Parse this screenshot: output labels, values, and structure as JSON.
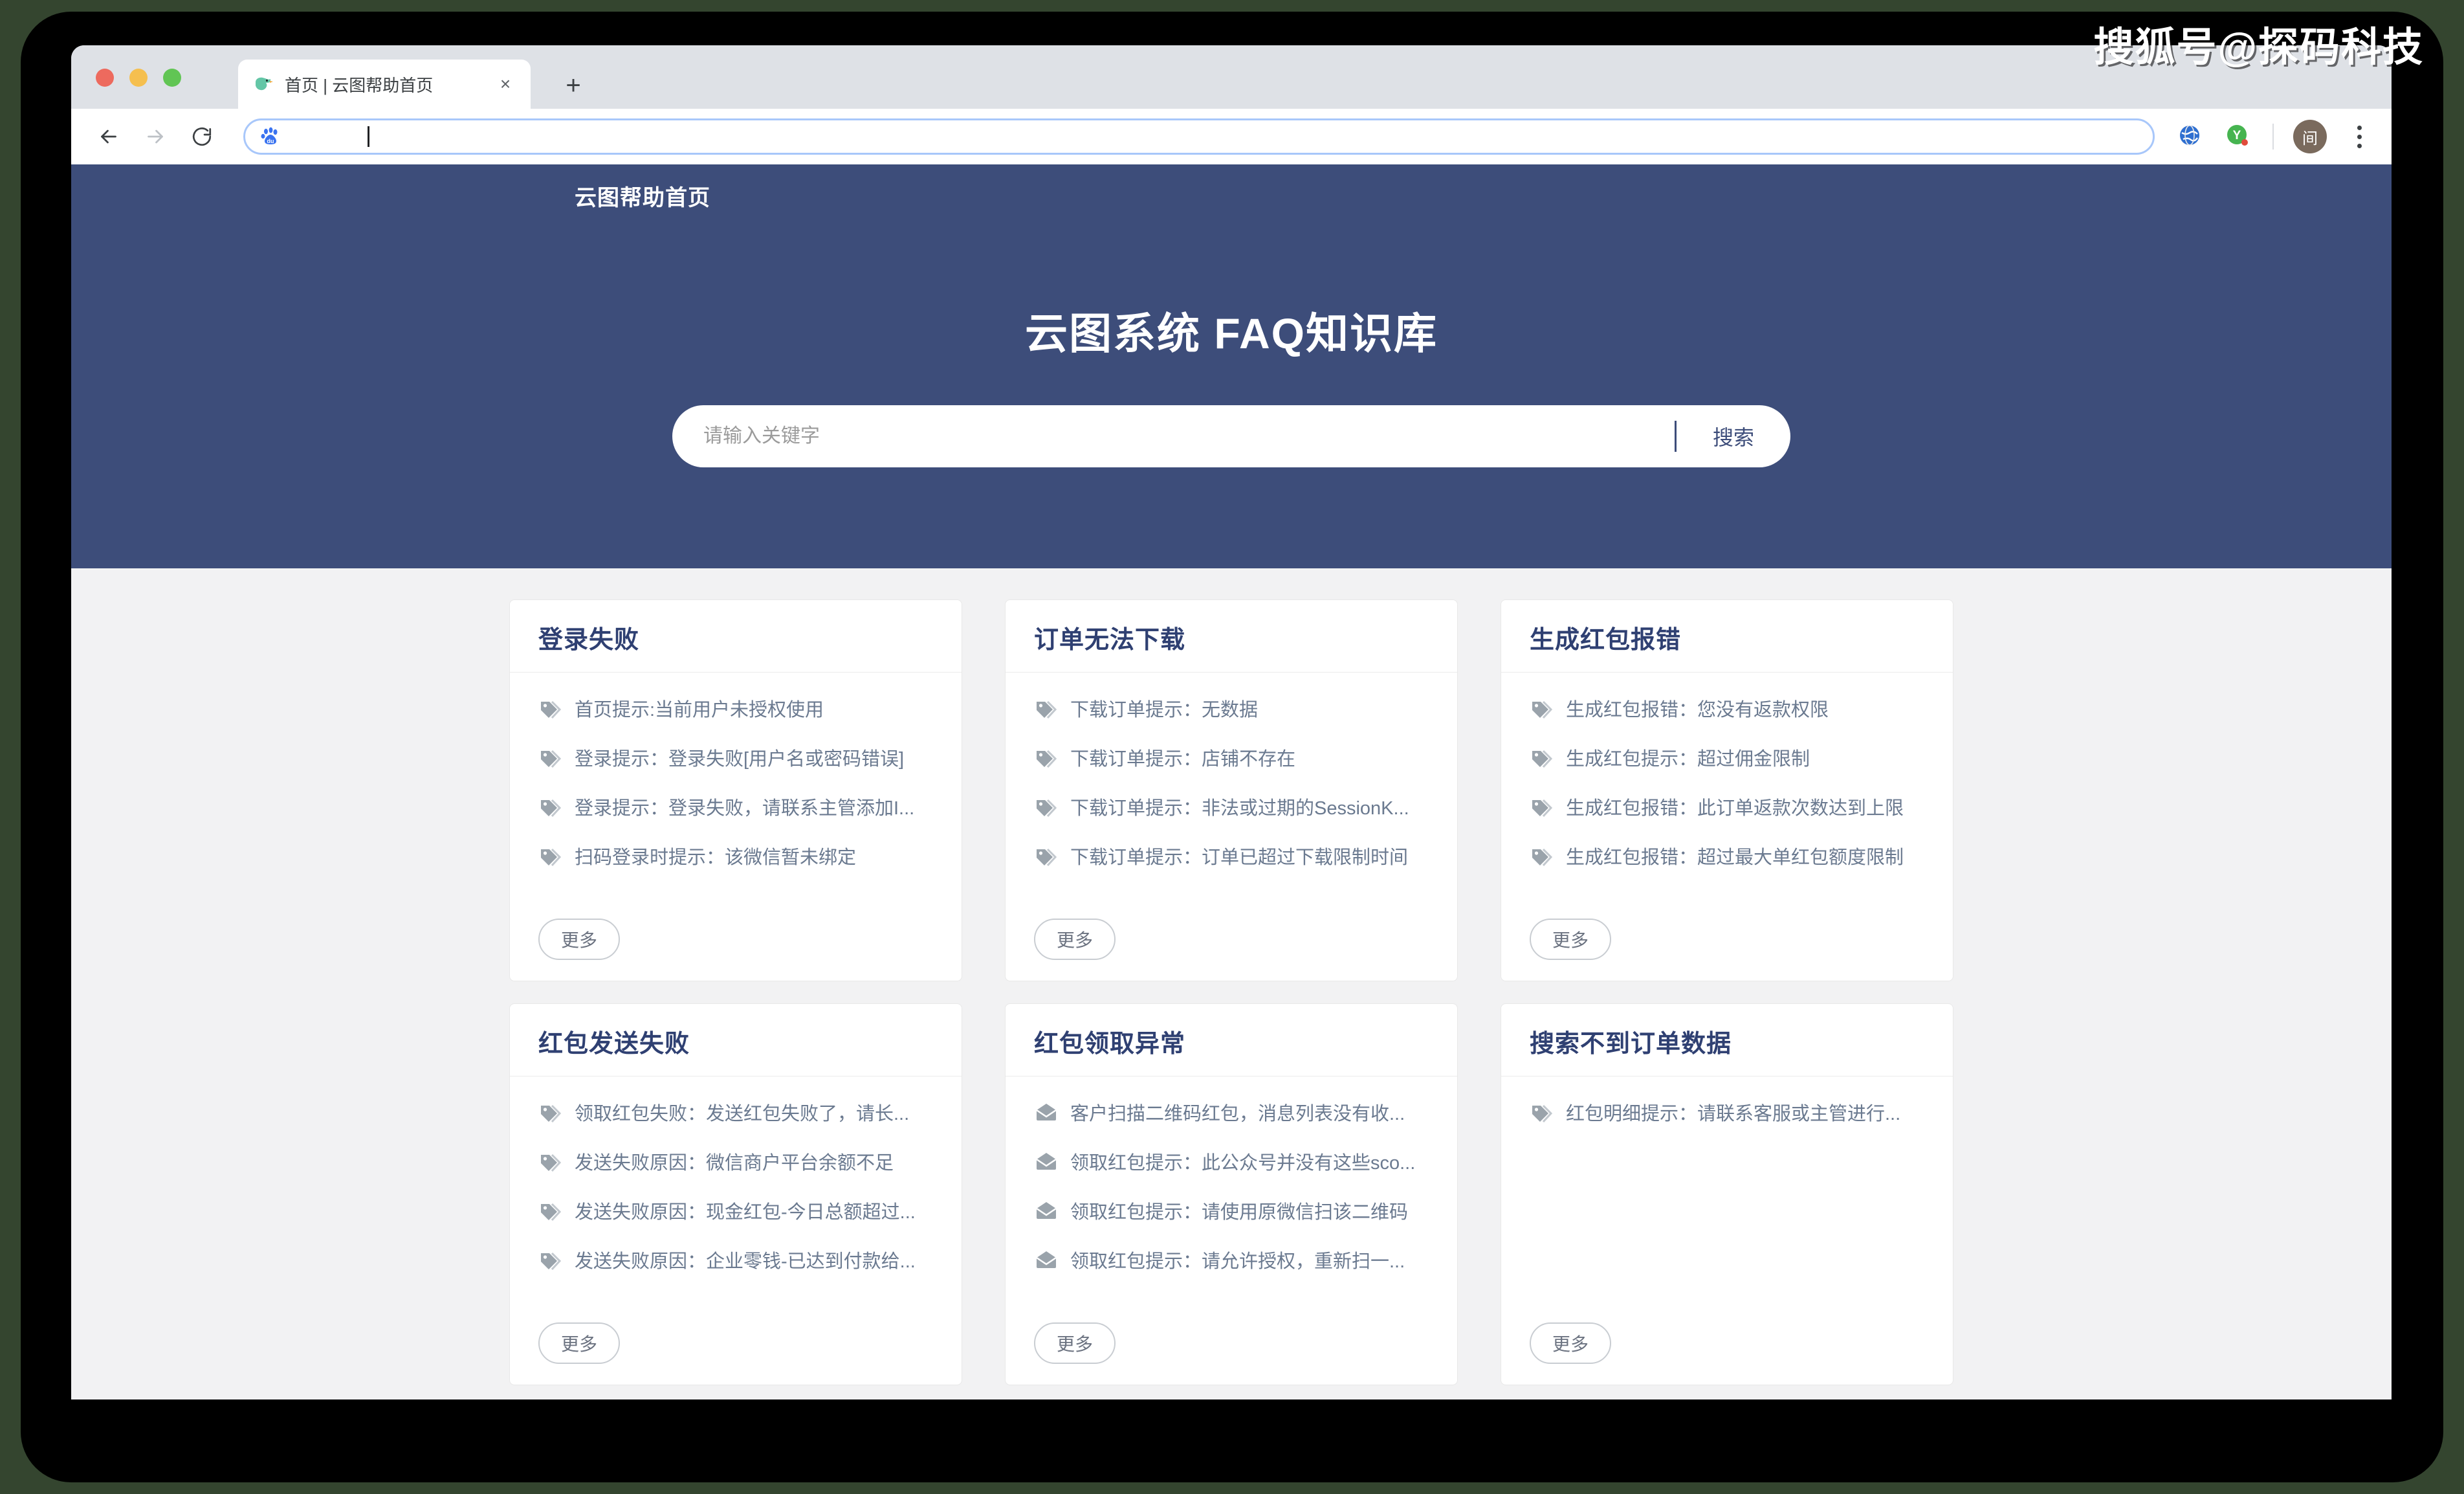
{
  "watermark": "搜狐号@探码科技",
  "browser": {
    "tab": {
      "title": "首页 | 云图帮助首页",
      "favicon": "bird-icon",
      "close": "×"
    },
    "new_tab": "+",
    "back_icon": "back-arrow-icon",
    "forward_icon": "forward-arrow-icon",
    "reload_icon": "reload-icon",
    "omnibox": {
      "value": "",
      "placeholder": "",
      "site_icon": "baidu-paw-icon"
    },
    "toolbar_icons": [
      "globe-icon",
      "youdao-icon"
    ],
    "avatar_label": "间",
    "menu_icon": "kebab-menu-icon"
  },
  "page": {
    "brand": "云图帮助首页",
    "hero_title": "云图系统 FAQ知识库",
    "search": {
      "placeholder": "请输入关键字",
      "value": "",
      "button": "搜索"
    },
    "more_label": "更多",
    "colors": {
      "hero_bg": "#3d4d7a",
      "content_bg": "#f2f2f3",
      "card_title": "#2f4072",
      "item_text": "#6b7a90"
    },
    "cards": [
      {
        "title": "登录失败",
        "icon": "tag-icon",
        "items": [
          "首页提示:当前用户未授权使用",
          "登录提示：登录失败[用户名或密码错误]",
          "登录提示：登录失败，请联系主管添加I...",
          "扫码登录时提示：该微信暂未绑定"
        ]
      },
      {
        "title": "订单无法下载",
        "icon": "tag-icon",
        "items": [
          "下载订单提示：无数据",
          "下载订单提示：店铺不存在",
          "下载订单提示：非法或过期的SessionK...",
          "下载订单提示：订单已超过下载限制时间"
        ]
      },
      {
        "title": "生成红包报错",
        "icon": "tag-icon",
        "items": [
          "生成红包报错：您没有返款权限",
          "生成红包提示：超过佣金限制",
          "生成红包报错：此订单返款次数达到上限",
          "生成红包报错：超过最大单红包额度限制"
        ]
      },
      {
        "title": "红包发送失败",
        "icon": "tag-icon",
        "items": [
          "领取红包失败：发送红包失败了，请长...",
          "发送失败原因：微信商户平台余额不足",
          "发送失败原因：现金红包-今日总额超过...",
          "发送失败原因：企业零钱-已达到付款给..."
        ]
      },
      {
        "title": "红包领取异常",
        "icon": "envelope-icon",
        "items": [
          "客户扫描二维码红包，消息列表没有收...",
          "领取红包提示：此公众号并没有这些sco...",
          "领取红包提示：请使用原微信扫该二维码",
          "领取红包提示：请允许授权，重新扫一..."
        ]
      },
      {
        "title": "搜索不到订单数据",
        "icon": "tag-icon",
        "items": [
          "红包明细提示：请联系客服或主管进行..."
        ]
      }
    ]
  }
}
